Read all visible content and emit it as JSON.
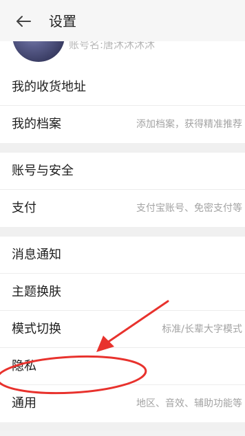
{
  "header": {
    "title": "设置",
    "back_icon": "arrow-left-icon"
  },
  "profile": {
    "account_name": "账号名:唐沐沐沐沐"
  },
  "sections": [
    {
      "rows": [
        {
          "label": "我的收货地址",
          "value": ""
        },
        {
          "label": "我的档案",
          "value": "添加档案，获得精准推荐"
        }
      ]
    },
    {
      "rows": [
        {
          "label": "账号与安全",
          "value": ""
        },
        {
          "label": "支付",
          "value": "支付宝账号、免密支付等"
        }
      ]
    },
    {
      "rows": [
        {
          "label": "消息通知",
          "value": ""
        },
        {
          "label": "主题换肤",
          "value": ""
        },
        {
          "label": "模式切换",
          "value": "标准/长辈大字模式"
        },
        {
          "label": "隐私",
          "value": ""
        },
        {
          "label": "通用",
          "value": "地区、音效、辅助功能等"
        }
      ]
    }
  ],
  "annotation": {
    "color": "#e8322d",
    "highlighted_item": "隐私"
  }
}
